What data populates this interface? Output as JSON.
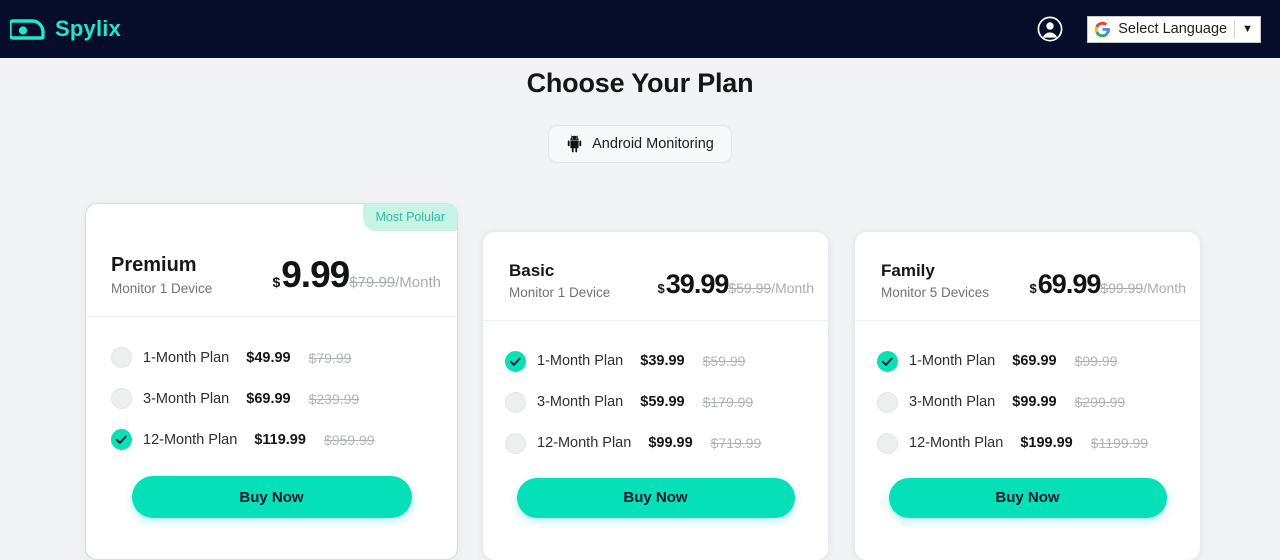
{
  "header": {
    "logo_text": "Spylix",
    "logo_icon": "spylix-eye-logo",
    "account_icon": "user-account-icon",
    "translate": {
      "icon": "google-g-icon",
      "label": "Select Language",
      "caret": "▼"
    }
  },
  "page": {
    "title": "Choose Your Plan"
  },
  "platform_tab": {
    "icon": "android-robot-icon",
    "label": "Android Monitoring"
  },
  "plans": [
    {
      "id": "premium",
      "badge": "Most Polular",
      "name": "Premium",
      "devices": "Monitor 1 Device",
      "currency": "$",
      "price": "9.99",
      "price_old": "$79.99",
      "per": "/Month",
      "options": [
        {
          "label": "1-Month Plan",
          "price": "$49.99",
          "old": "$79.99",
          "selected": false
        },
        {
          "label": "3-Month Plan",
          "price": "$69.99",
          "old": "$239.99",
          "selected": false
        },
        {
          "label": "12-Month Plan",
          "price": "$119.99",
          "old": "$959.99",
          "selected": true
        }
      ],
      "buy_label": "Buy Now"
    },
    {
      "id": "basic",
      "name": "Basic",
      "devices": "Monitor 1 Device",
      "currency": "$",
      "price": "39.99",
      "price_old": "$59.99",
      "per": "/Month",
      "options": [
        {
          "label": "1-Month Plan",
          "price": "$39.99",
          "old": "$59.99",
          "selected": true
        },
        {
          "label": "3-Month Plan",
          "price": "$59.99",
          "old": "$179.99",
          "selected": false
        },
        {
          "label": "12-Month Plan",
          "price": "$99.99",
          "old": "$719.99",
          "selected": false
        }
      ],
      "buy_label": "Buy Now"
    },
    {
      "id": "family",
      "name": "Family",
      "devices": "Monitor 5 Devices",
      "currency": "$",
      "price": "69.99",
      "price_old": "$99.99",
      "per": "/Month",
      "options": [
        {
          "label": "1-Month Plan",
          "price": "$69.99",
          "old": "$99.99",
          "selected": true
        },
        {
          "label": "3-Month Plan",
          "price": "$99.99",
          "old": "$299.99",
          "selected": false
        },
        {
          "label": "12-Month Plan",
          "price": "$199.99",
          "old": "$1199.99",
          "selected": false
        }
      ],
      "buy_label": "Buy Now"
    }
  ],
  "colors": {
    "header_bg": "#050d2b",
    "page_bg": "#f1f3f5",
    "accent": "#05e0b8",
    "logo_teal": "#1ee8c6",
    "badge_bg": "#c8f3e7",
    "badge_text": "#2bbd9e"
  }
}
